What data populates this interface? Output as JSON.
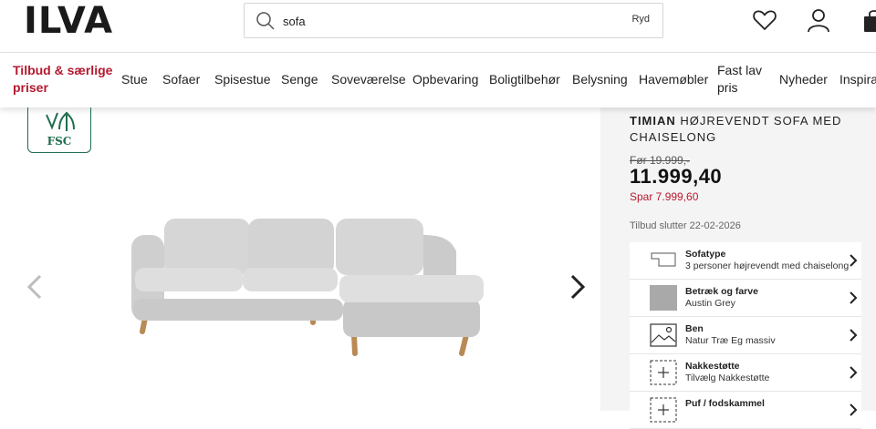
{
  "header": {
    "logo": "ILVA",
    "search": {
      "value": "sofa",
      "clear_label": "Ryd"
    },
    "icons": [
      "heart-icon",
      "user-icon",
      "bag-icon"
    ]
  },
  "nav": {
    "items": [
      {
        "label": "Tilbud & særlige priser",
        "promo": true
      },
      {
        "label": "Stue"
      },
      {
        "label": "Sofaer"
      },
      {
        "label": "Spisestue"
      },
      {
        "label": "Senge"
      },
      {
        "label": "Soveværelse"
      },
      {
        "label": "Opbevaring"
      },
      {
        "label": "Boligtilbehør"
      },
      {
        "label": "Belysning"
      },
      {
        "label": "Havemøbler"
      },
      {
        "label": "Fast lav pris"
      },
      {
        "label": "Nyheder"
      },
      {
        "label": "Inspiration"
      }
    ]
  },
  "gallery": {
    "badge": "FSC",
    "prev_icon": "chevron-left-icon",
    "next_icon": "chevron-right-icon"
  },
  "product": {
    "brand": "TIMIAN",
    "name": "HØJREVENDT SOFA MED CHAISELONG",
    "old_price": "Før 19.999,-",
    "price": "11.999,40",
    "savings": "Spar 7.999,60",
    "offer_ends": "Tilbud slutter 22-02-2026",
    "accent_color": "#b5192f",
    "options": [
      {
        "title": "Sofatype",
        "value": "3 personer højrevendt med chaiselong",
        "icon": "sofa-outline-icon"
      },
      {
        "title": "Betræk og farve",
        "value": "Austin Grey",
        "icon": "fabric-swatch-icon"
      },
      {
        "title": "Ben",
        "value": "Natur Træ Eg massiv",
        "icon": "image-placeholder-icon"
      },
      {
        "title": "Nakkestøtte",
        "value": "Tilvælg Nakkestøtte",
        "icon": "add-icon"
      },
      {
        "title": "Puf / fodskammel",
        "value": "",
        "icon": "add-icon"
      }
    ]
  }
}
